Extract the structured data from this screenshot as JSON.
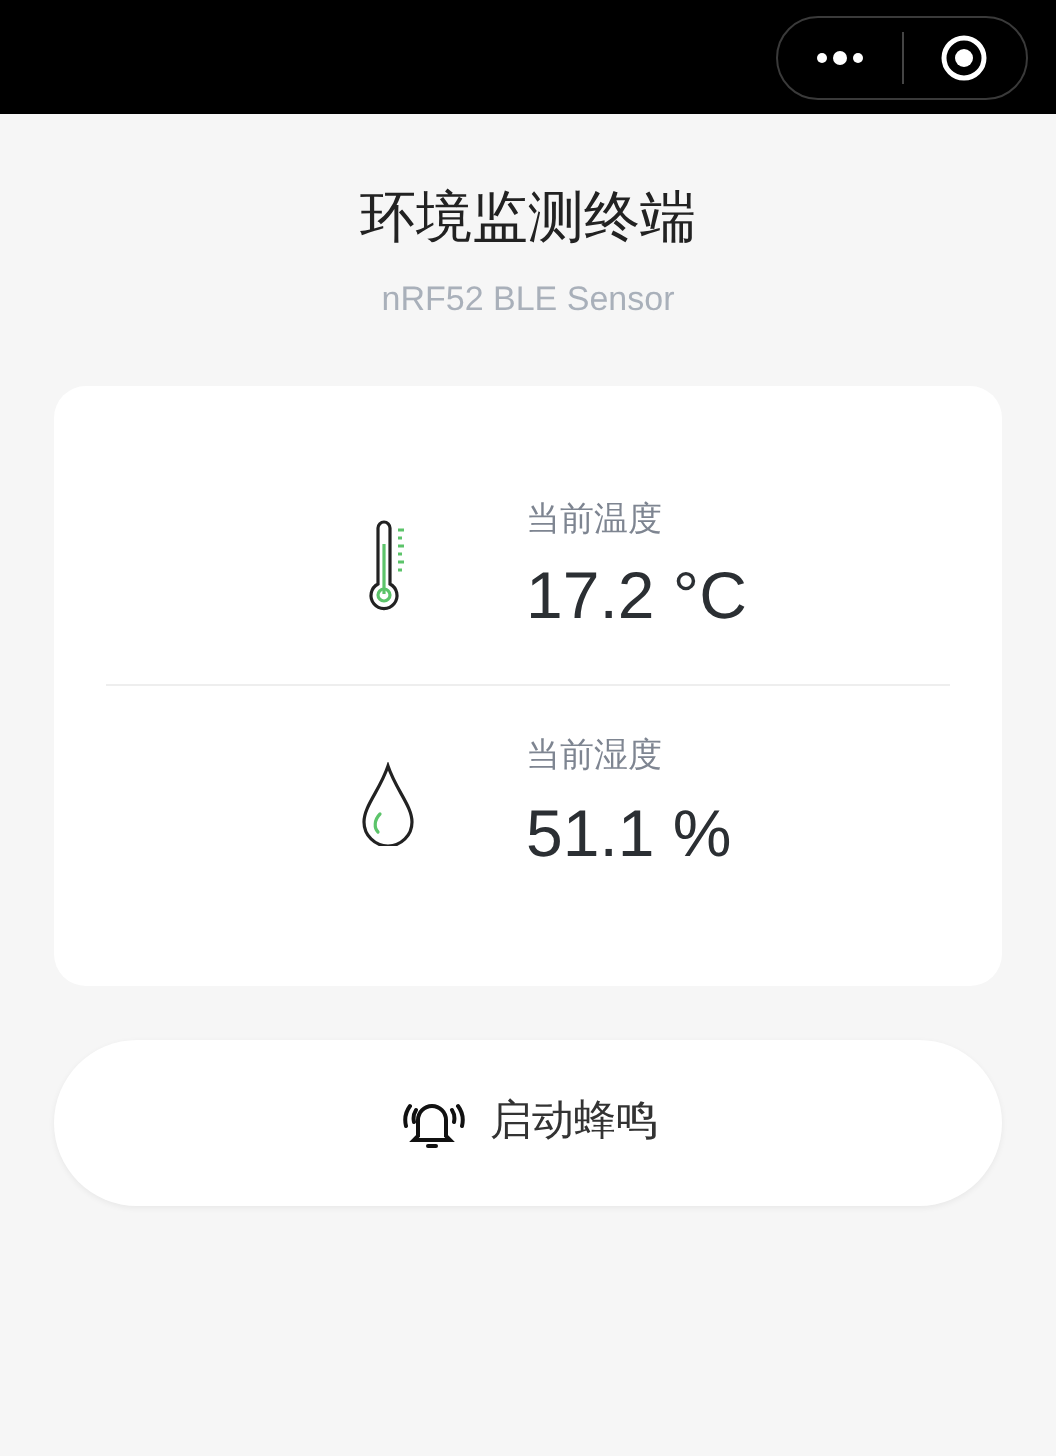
{
  "header": {
    "title": "环境监测终端",
    "subtitle": "nRF52 BLE Sensor"
  },
  "metrics": [
    {
      "kind": "temperature",
      "label": "当前温度",
      "value": "17.2 °C"
    },
    {
      "kind": "humidity",
      "label": "当前湿度",
      "value": "51.1 %"
    }
  ],
  "action_button": {
    "label": "启动蜂鸣"
  }
}
